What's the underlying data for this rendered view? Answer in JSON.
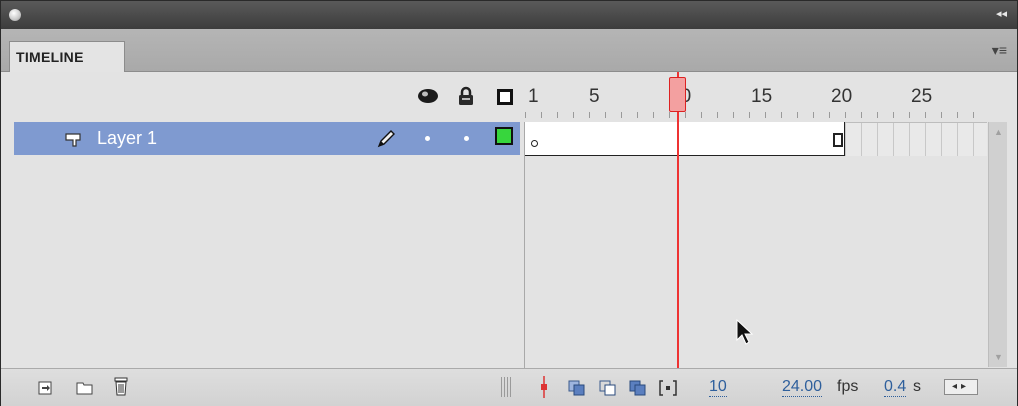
{
  "panel": {
    "tab_label": "TIMELINE",
    "collapse_glyph": "◂◂",
    "menu_glyph": "▾≡"
  },
  "header": {
    "icons": [
      "eye-icon",
      "lock-icon",
      "outline-icon"
    ],
    "ruler_labels": [
      "1",
      "5",
      "10",
      "15",
      "20",
      "25"
    ]
  },
  "layers": [
    {
      "name": "Layer 1",
      "color": "#37d63d",
      "selected": true,
      "keyframe_start": 1,
      "keyframe_end": 20
    }
  ],
  "playhead": {
    "frame": 10,
    "color": "#e33333"
  },
  "bottom": {
    "current_frame": "10",
    "frame_rate_value": "24.00",
    "frame_rate_unit": "fps",
    "elapsed_value": "0.4",
    "elapsed_unit": "s",
    "scroll_glyphs": "◂▸"
  },
  "colors": {
    "selection": "#7f9ad0",
    "accent_blue": "#2e5f9c",
    "panel_bg": "#e3e3e3"
  }
}
